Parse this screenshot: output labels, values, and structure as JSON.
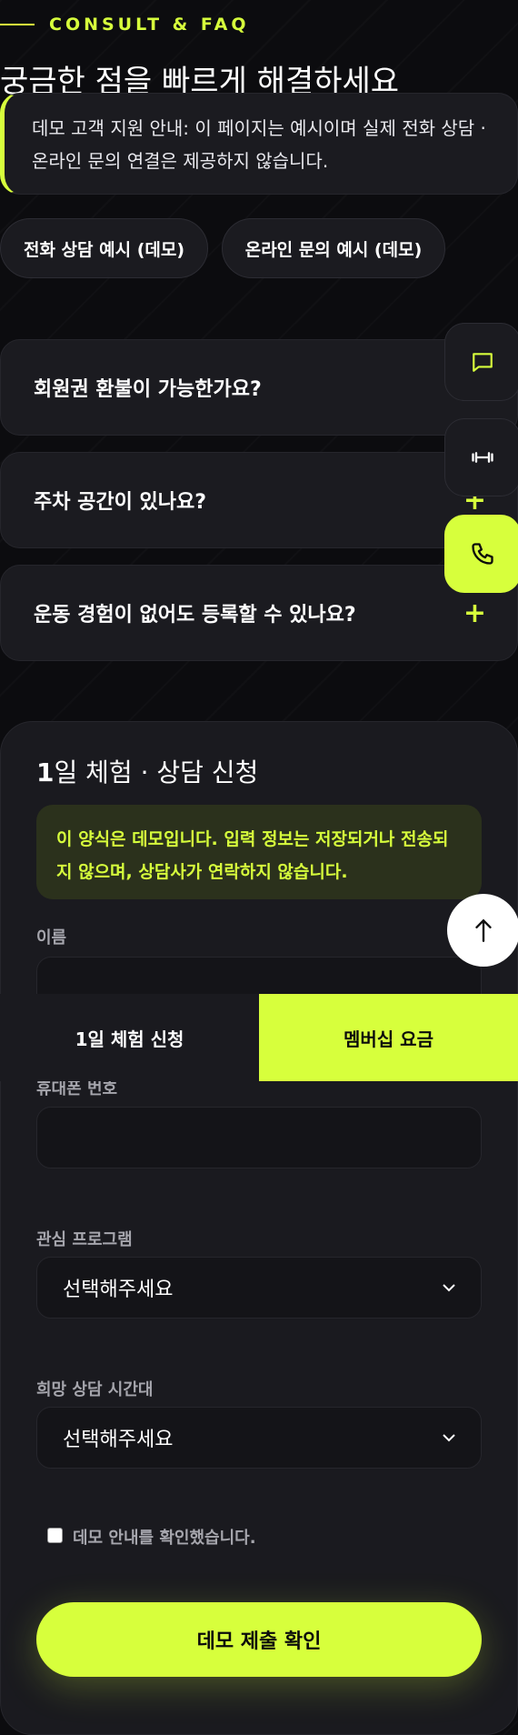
{
  "header": {
    "eyebrow": "CONSULT & FAQ",
    "headline": "궁금한 점을 빠르게 해결하세요"
  },
  "notice": {
    "text": "데모 고객 지원 안내: 이 페이지는 예시이며 실제 전화 상담 · 온라인 문의 연결은 제공하지 않습니다."
  },
  "contact_buttons": [
    {
      "label": "전화 상담 예시 (데모)"
    },
    {
      "label": "온라인 문의 예시 (데모)"
    }
  ],
  "faq": [
    {
      "question": "회원권 환불이 가능한가요?",
      "toggle": "+"
    },
    {
      "question": "주차 공간이 있나요?",
      "toggle": "+"
    },
    {
      "question": "운동 경험이 없어도 등록할 수 있나요?",
      "toggle": "+"
    }
  ],
  "floating": {
    "icons": [
      "chat-icon",
      "dumbbell-icon",
      "phone-icon",
      "arrow-up-icon"
    ],
    "accent": "#d7ff3c"
  },
  "form": {
    "title_bold": "1",
    "title_rest": "일 체험 · 상담 신청",
    "warning": "이 양식은 데모입니다. 입력 정보는 저장되거나 전송되지 않으며, 상담사가 연락하지 않습니다.",
    "fields": {
      "name_label": "이름",
      "phone_label": "휴대폰 번호",
      "program_label": "관심 프로그램",
      "program_value": "선택해주세요",
      "time_label": "희망 상담 시간대",
      "time_value": "선택해주세요"
    },
    "checkbox_label": "데모 안내를 확인했습니다.",
    "submit_label": "데모 제출 확인"
  },
  "bottom_tabs": [
    {
      "label": "1일 체험 신청"
    },
    {
      "label": "멤버십 요금"
    }
  ],
  "colors": {
    "accent": "#d7ff3c",
    "background": "#0c0c0f",
    "card": "#1b1b20"
  }
}
